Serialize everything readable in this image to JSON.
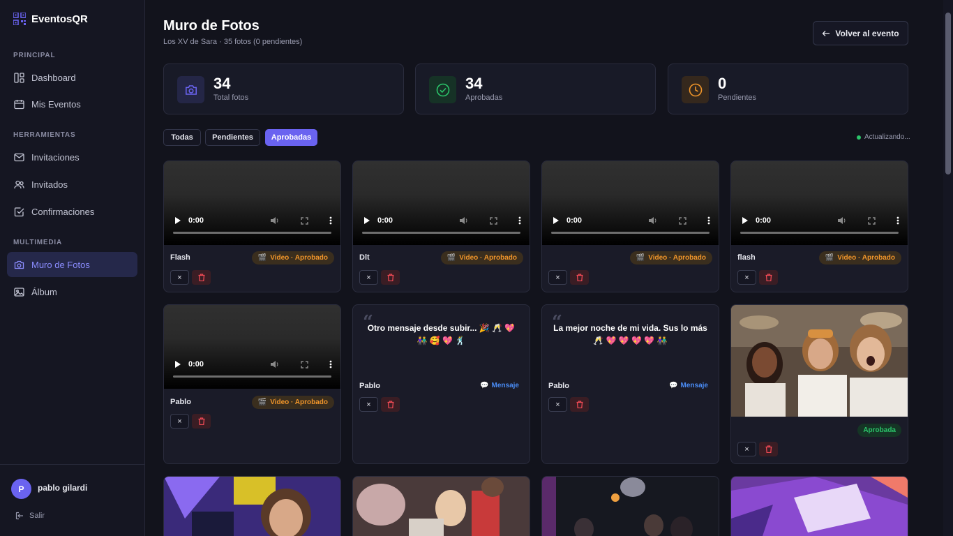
{
  "brand": {
    "name": "EventosQR",
    "icon": "qr-icon"
  },
  "sidebar": {
    "sections": [
      {
        "label": "PRINCIPAL"
      },
      {
        "label": "HERRAMIENTAS"
      },
      {
        "label": "MULTIMEDIA"
      }
    ],
    "items": [
      {
        "label": "Dashboard",
        "icon": "dashboard-icon"
      },
      {
        "label": "Mis Eventos",
        "icon": "calendar-icon"
      },
      {
        "label": "Invitaciones",
        "icon": "mail-icon"
      },
      {
        "label": "Invitados",
        "icon": "users-icon"
      },
      {
        "label": "Confirmaciones",
        "icon": "check-square-icon"
      },
      {
        "label": "Muro de Fotos",
        "icon": "camera-icon",
        "active": true
      },
      {
        "label": "Álbum",
        "icon": "image-icon"
      }
    ],
    "user": {
      "initial": "P",
      "name": "pablo gilardi"
    },
    "logout": "Salir"
  },
  "header": {
    "title": "Muro de Fotos",
    "subtitle": "Los XV de Sara · 35 fotos (0 pendientes)",
    "back_label": "Volver al evento"
  },
  "stats": [
    {
      "value": "34",
      "label": "Total fotos",
      "color": "#6a63f0"
    },
    {
      "value": "34",
      "label": "Aprobadas",
      "color": "#2bc46a"
    },
    {
      "value": "0",
      "label": "Pendientes",
      "color": "#f0952a"
    }
  ],
  "filters": [
    {
      "label": "Todas"
    },
    {
      "label": "Pendientes"
    },
    {
      "label": "Aprobadas",
      "active": true
    }
  ],
  "live_status": "Actualizando...",
  "video": {
    "time": "0:00"
  },
  "cards": [
    {
      "type": "video",
      "name": "Flash",
      "badge": "Video · Aprobado"
    },
    {
      "type": "video",
      "name": "Dlt",
      "badge": "Video · Aprobado"
    },
    {
      "type": "video",
      "name": "",
      "badge": "Video · Aprobado"
    },
    {
      "type": "video",
      "name": "flash",
      "badge": "Video · Aprobado"
    },
    {
      "type": "video",
      "name": "Pablo",
      "badge": "Video · Aprobado"
    },
    {
      "type": "message",
      "name": "Pablo",
      "badge": "Mensaje",
      "text": "Otro mensaje desde subir... 🎉 🥂 💖 👫 🥰 💖 🕺"
    },
    {
      "type": "message",
      "name": "Pablo",
      "badge": "Mensaje",
      "text": "La mejor noche de mi vida. Sus lo más 🥂 💖 💖 💖 💖 👫"
    },
    {
      "type": "photo",
      "name": "",
      "badge": "Aprobada"
    }
  ],
  "action_labels": {
    "reject": "×"
  }
}
